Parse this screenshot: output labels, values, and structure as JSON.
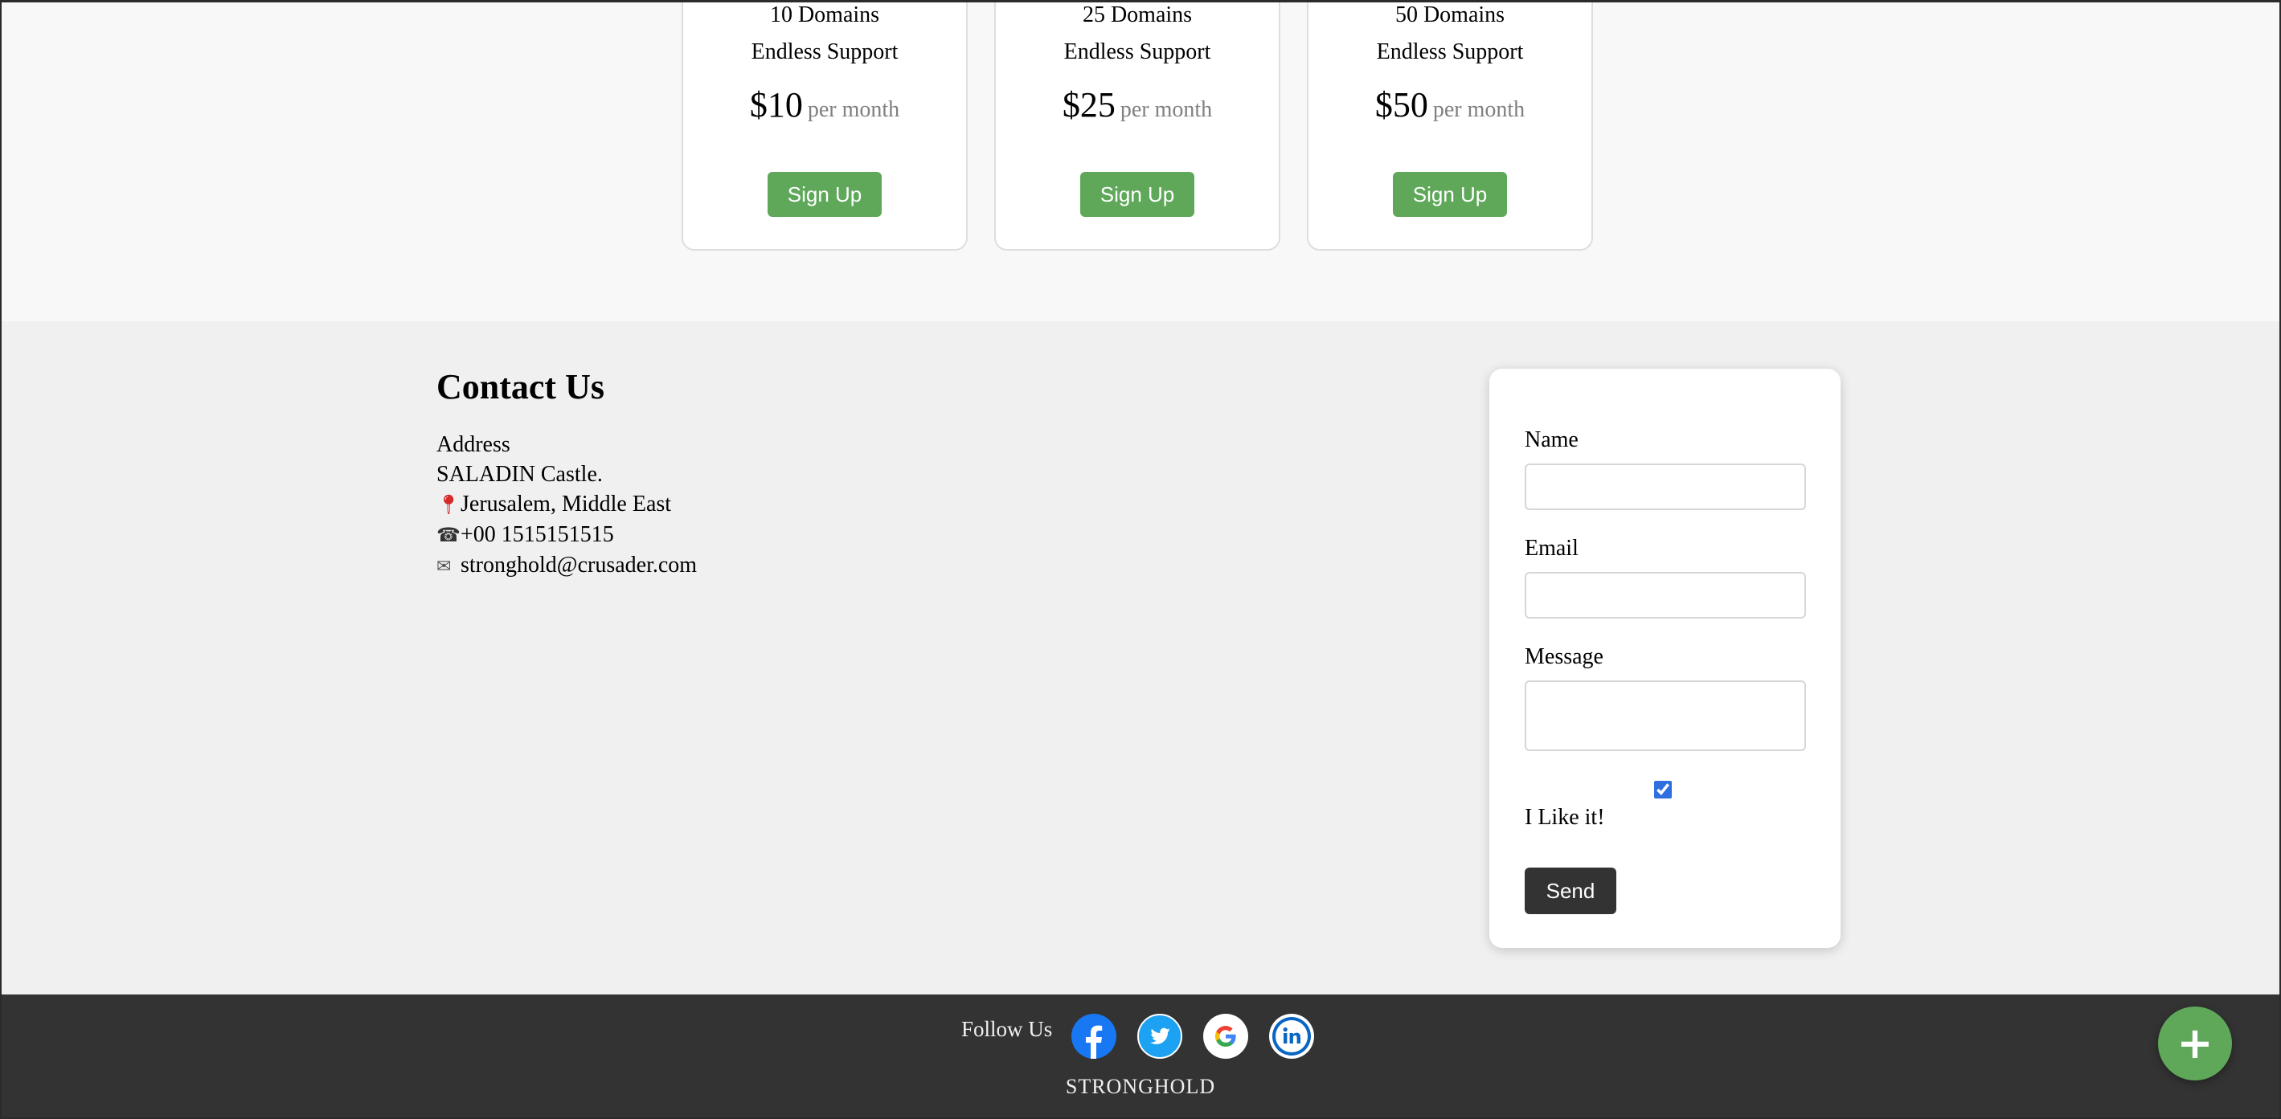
{
  "pricing": {
    "plans": [
      {
        "domains": "10 Domains",
        "support": "Endless Support",
        "price": "$10",
        "period": "per month",
        "button": "Sign Up"
      },
      {
        "domains": "25 Domains",
        "support": "Endless Support",
        "price": "$25",
        "period": "per month",
        "button": "Sign Up"
      },
      {
        "domains": "50 Domains",
        "support": "Endless Support",
        "price": "$50",
        "period": "per month",
        "button": "Sign Up"
      }
    ],
    "button_color": "#5fa85a"
  },
  "contact": {
    "title": "Contact Us",
    "address_label": "Address",
    "address_line": "SALADIN Castle.",
    "location": "Jerusalem, Middle East",
    "phone": "+00 1515151515",
    "email": "stronghold@crusader.com",
    "icons": [
      "pin-icon",
      "phone-icon",
      "email-icon"
    ]
  },
  "form": {
    "name_label": "Name",
    "name_value": "",
    "email_label": "Email",
    "email_value": "",
    "message_label": "Message",
    "message_value": "",
    "like_label": "I Like it!",
    "like_checked": true,
    "send_label": "Send"
  },
  "footer": {
    "follow_label": "Follow Us",
    "social": [
      {
        "name": "facebook-icon",
        "color": "#1877f2"
      },
      {
        "name": "twitter-icon",
        "color": "#1da1f2"
      },
      {
        "name": "google-icon",
        "color": "#ffffff"
      },
      {
        "name": "linkedin-icon",
        "color": "#0a66c2"
      }
    ],
    "brand": "STRONGHOLD",
    "background": "#333333"
  },
  "fab": {
    "icon": "plus-icon",
    "color": "#5fa85a"
  }
}
